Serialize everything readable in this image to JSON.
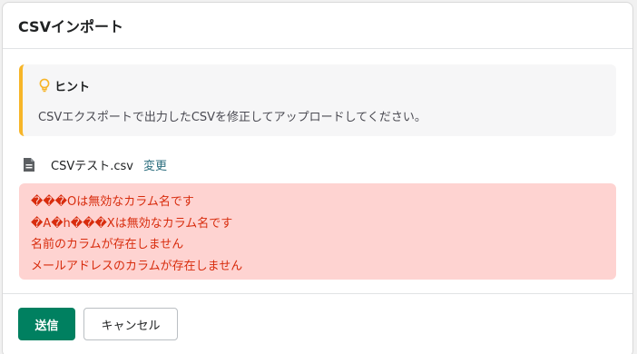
{
  "modal": {
    "title": "CSVインポート"
  },
  "hint": {
    "title": "ヒント",
    "text": "CSVエクスポートで出力したCSVを修正してアップロードしてください。",
    "icon": "lightbulb-icon",
    "accent_color": "#f7b528"
  },
  "file": {
    "icon": "file-icon",
    "name": "CSVテスト.csv",
    "change_label": "変更"
  },
  "errors": [
    "���Oは無効なカラム名です",
    "�A�h���Xは無効なカラム名です",
    "名前のカラムが存在しません",
    "メールアドレスのカラムが存在しません"
  ],
  "footer": {
    "submit_label": "送信",
    "cancel_label": "キャンセル"
  },
  "colors": {
    "primary": "#008060",
    "error_bg": "#fed3d1",
    "error_text": "#d82c0d",
    "link": "#2c6e7e"
  }
}
